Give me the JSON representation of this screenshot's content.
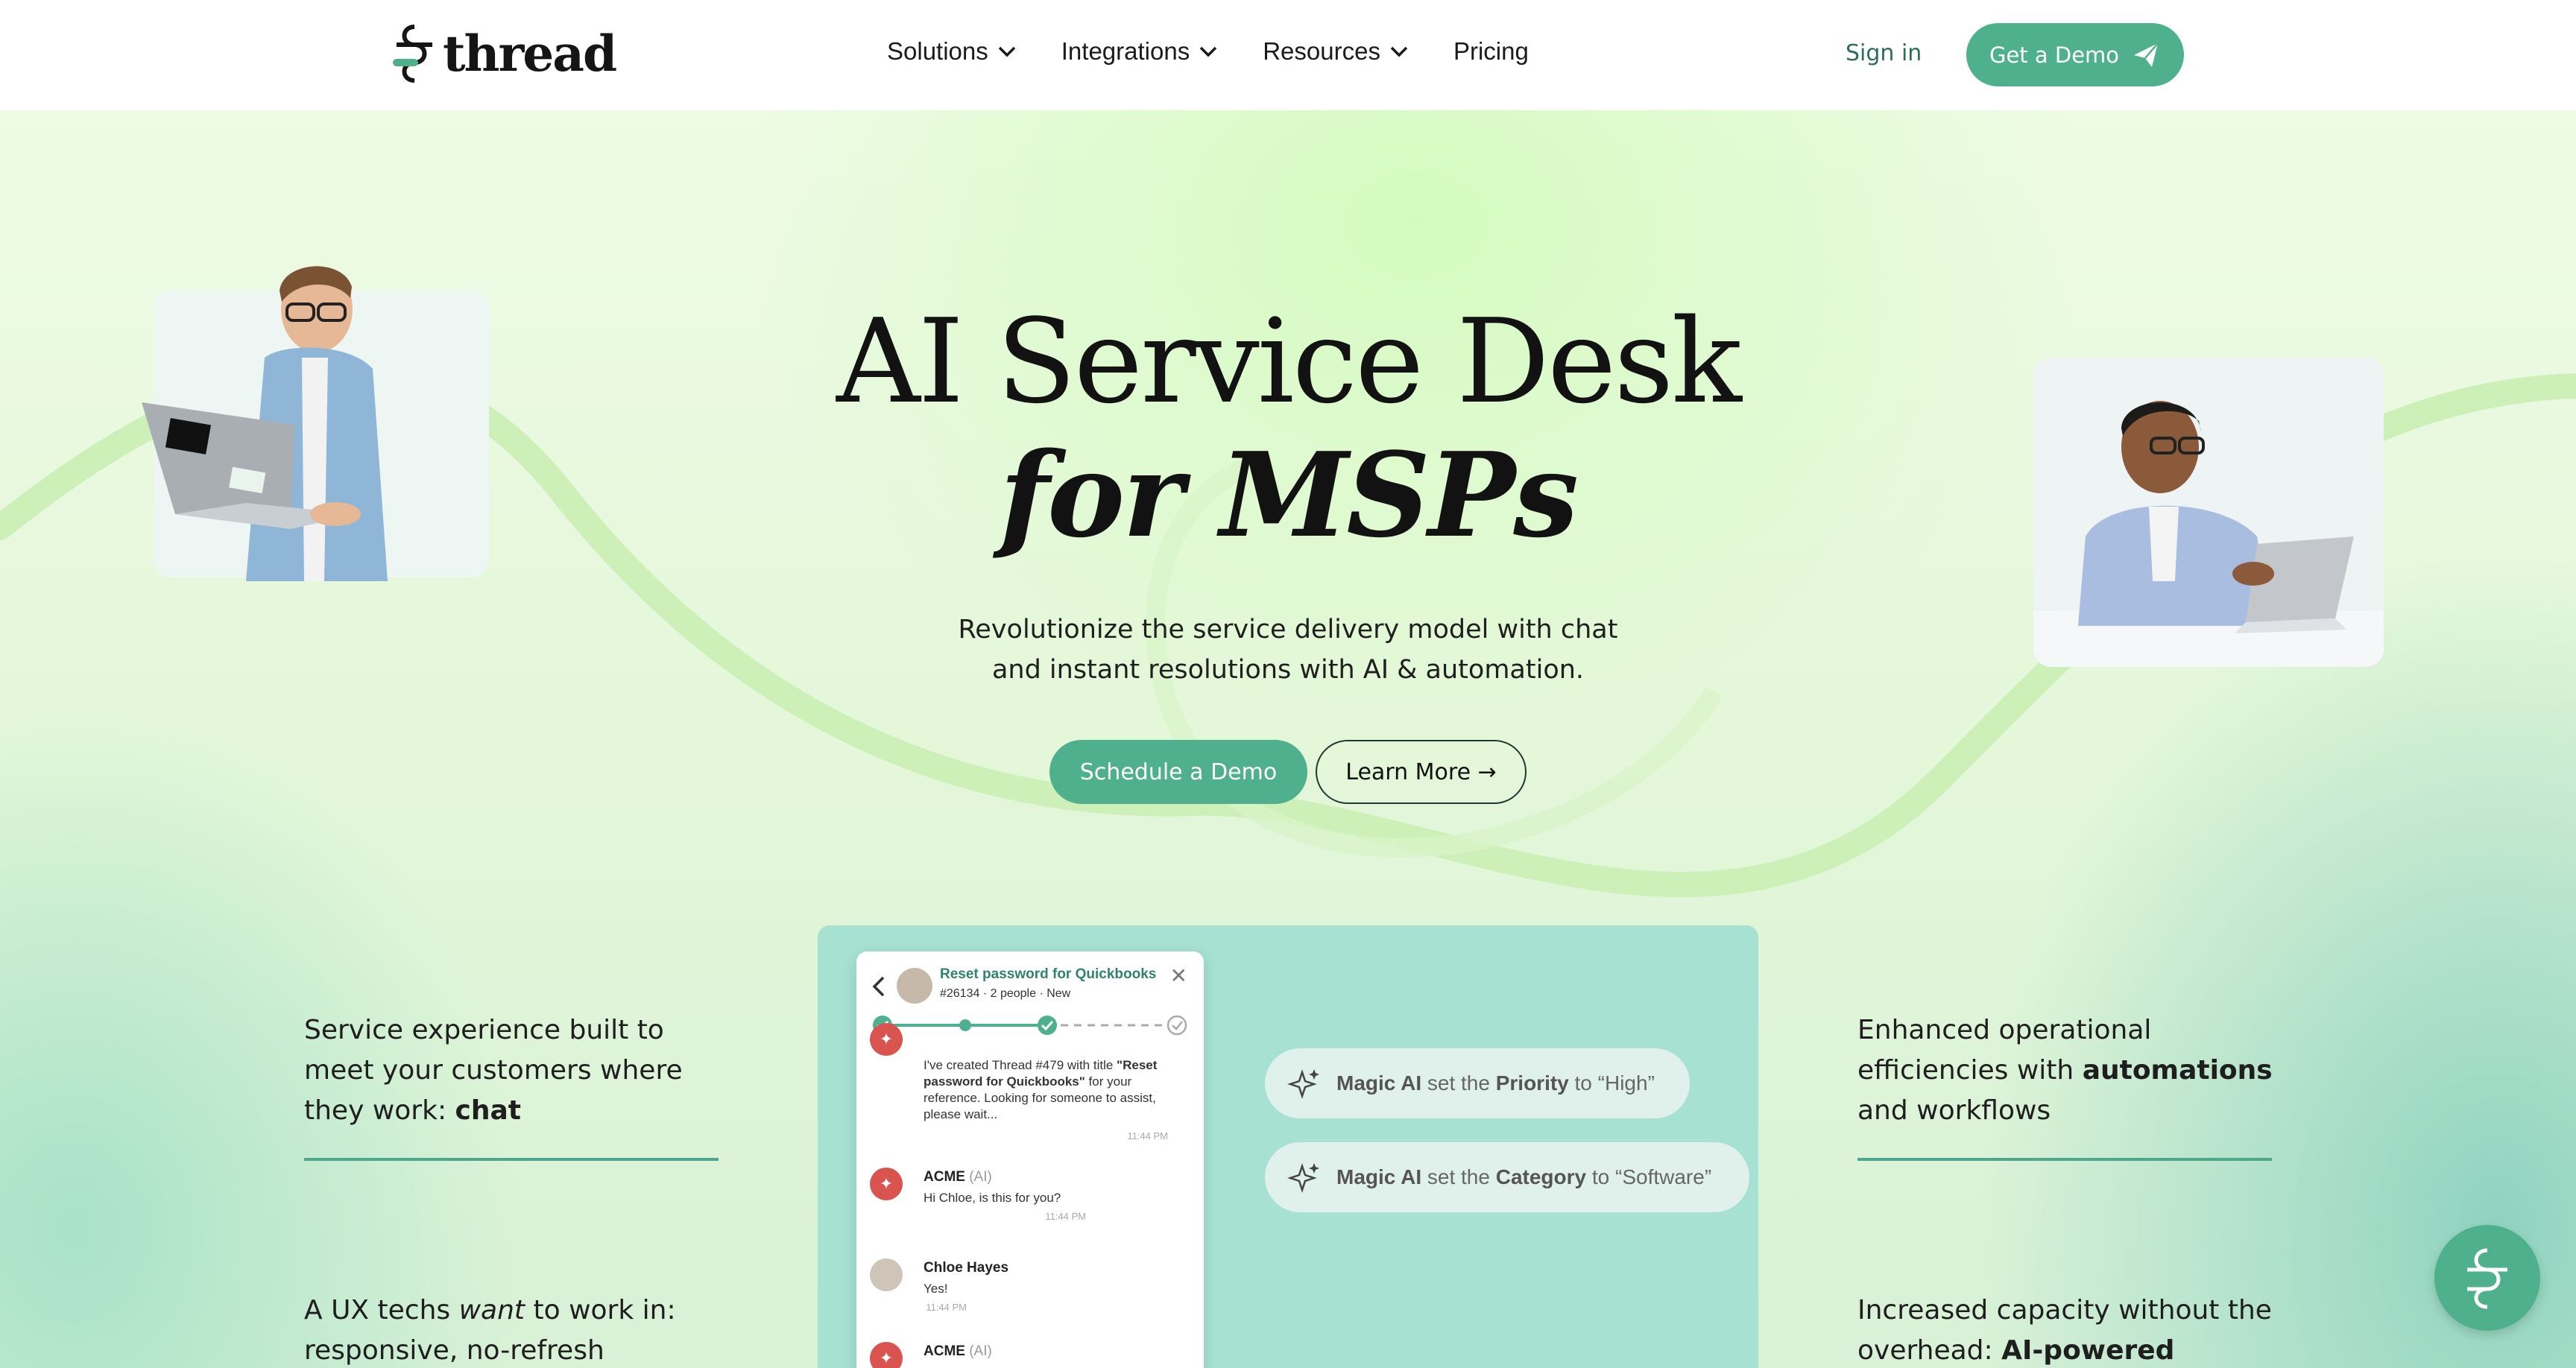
{
  "header": {
    "logo_text": "thread",
    "nav": [
      {
        "label": "Solutions",
        "has_dropdown": true
      },
      {
        "label": "Integrations",
        "has_dropdown": true
      },
      {
        "label": "Resources",
        "has_dropdown": true
      },
      {
        "label": "Pricing",
        "has_dropdown": false
      }
    ],
    "signin_label": "Sign in",
    "demo_label": "Get a Demo",
    "demo_icon": "paper-plane-icon"
  },
  "hero": {
    "title_line1": "AI Service Desk",
    "title_line2": "for MSPs",
    "subtitle_line1": "Revolutionize the service delivery model with chat",
    "subtitle_line2": "and instant resolutions with AI & automation.",
    "primary_cta": "Schedule a Demo",
    "secondary_cta": "Learn More →"
  },
  "features": {
    "left_top": {
      "pre": "Service experience built to meet your customers where they work: ",
      "bold": "chat"
    },
    "left_bottom": {
      "pre": "A UX techs ",
      "italic": "want",
      "post": " to work in: responsive, no-refresh"
    },
    "right_top": {
      "pre": "Enhanced operational efficiencies with ",
      "bold": "automations",
      "post": " and workflows"
    },
    "right_bottom": {
      "pre": "Increased capacity without the overhead: ",
      "bold": "AI-powered admin"
    }
  },
  "chat": {
    "ticket_title": "Reset password for Quickbooks",
    "ticket_meta": "#26134 · 2 people · New",
    "messages": [
      {
        "name": "ACME",
        "tag": "(AI)",
        "text_pre": "I've created Thread #479 with title ",
        "text_bold": "\"Reset password for Quickbooks\"",
        "text_post": " for your reference. Looking for someone to assist, please wait...",
        "time": "11:44 PM"
      },
      {
        "name": "ACME",
        "tag": "(AI)",
        "text": "Hi Chloe, is this for you?",
        "time": "11:44 PM"
      },
      {
        "name": "Chloe Hayes",
        "tag": "",
        "text": "Yes!",
        "time": "11:44 PM"
      },
      {
        "name": "ACME",
        "tag": "(AI)",
        "text": "",
        "time": ""
      }
    ]
  },
  "magic": [
    {
      "actor": "Magic AI",
      "mid": " set the ",
      "field": "Priority",
      "post": " to “High”"
    },
    {
      "actor": "Magic AI",
      "mid": " set the ",
      "field": "Category",
      "post": " to “Software”"
    }
  ],
  "colors": {
    "brand": "#4fb08d",
    "brand_dark": "#2c6e5a",
    "panel": "#a6e1d1"
  }
}
